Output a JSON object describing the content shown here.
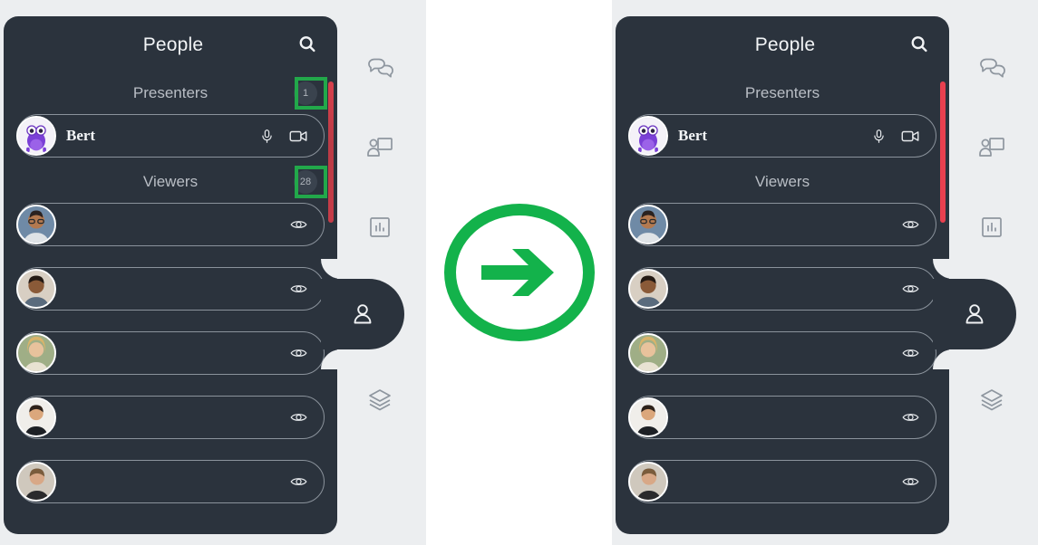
{
  "comparison": {
    "arrow_icon": "arrow-right-circle-icon",
    "accent_color": "#13b24b",
    "highlight_color": "#22a84a",
    "scrollbar_color": "#e8404f",
    "panel_bg": "#2b333d",
    "rail_bg": "#eceef0"
  },
  "panels": [
    {
      "id": "before",
      "header": {
        "title": "People",
        "search_icon": "search-icon"
      },
      "sections": [
        {
          "label": "Presenters",
          "count": "1",
          "highlighted": true
        },
        {
          "label": "Viewers",
          "count": "28",
          "highlighted": true
        }
      ],
      "presenters": [
        {
          "name": "Bert",
          "avatar": "monster-avatar",
          "actions": [
            "microphone-icon",
            "camera-icon"
          ]
        }
      ],
      "viewers": [
        {
          "name": "",
          "avatar": "photo-avatar-1",
          "actions": [
            "eye-icon"
          ]
        },
        {
          "name": "",
          "avatar": "photo-avatar-2",
          "actions": [
            "eye-icon"
          ]
        },
        {
          "name": "",
          "avatar": "photo-avatar-3",
          "actions": [
            "eye-icon"
          ]
        },
        {
          "name": "",
          "avatar": "photo-avatar-4",
          "actions": [
            "eye-icon"
          ]
        },
        {
          "name": "",
          "avatar": "photo-avatar-5",
          "actions": [
            "eye-icon"
          ]
        }
      ]
    },
    {
      "id": "after",
      "header": {
        "title": "People",
        "search_icon": "search-icon"
      },
      "sections": [
        {
          "label": "Presenters",
          "count": "",
          "highlighted": false
        },
        {
          "label": "Viewers",
          "count": "",
          "highlighted": false
        }
      ],
      "presenters": [
        {
          "name": "Bert",
          "avatar": "monster-avatar",
          "actions": [
            "microphone-icon",
            "camera-icon"
          ]
        }
      ],
      "viewers": [
        {
          "name": "",
          "avatar": "photo-avatar-1",
          "actions": [
            "eye-icon"
          ]
        },
        {
          "name": "",
          "avatar": "photo-avatar-2",
          "actions": [
            "eye-icon"
          ]
        },
        {
          "name": "",
          "avatar": "photo-avatar-3",
          "actions": [
            "eye-icon"
          ]
        },
        {
          "name": "",
          "avatar": "photo-avatar-4",
          "actions": [
            "eye-icon"
          ]
        },
        {
          "name": "",
          "avatar": "photo-avatar-5",
          "actions": [
            "eye-icon"
          ]
        }
      ]
    }
  ],
  "rail": {
    "items": [
      {
        "icon": "chat-icon",
        "active": false
      },
      {
        "icon": "screen-share-icon",
        "active": false
      },
      {
        "icon": "poll-chart-icon",
        "active": false
      },
      {
        "icon": "people-icon",
        "active": true
      },
      {
        "icon": "layers-icon",
        "active": false
      }
    ]
  }
}
